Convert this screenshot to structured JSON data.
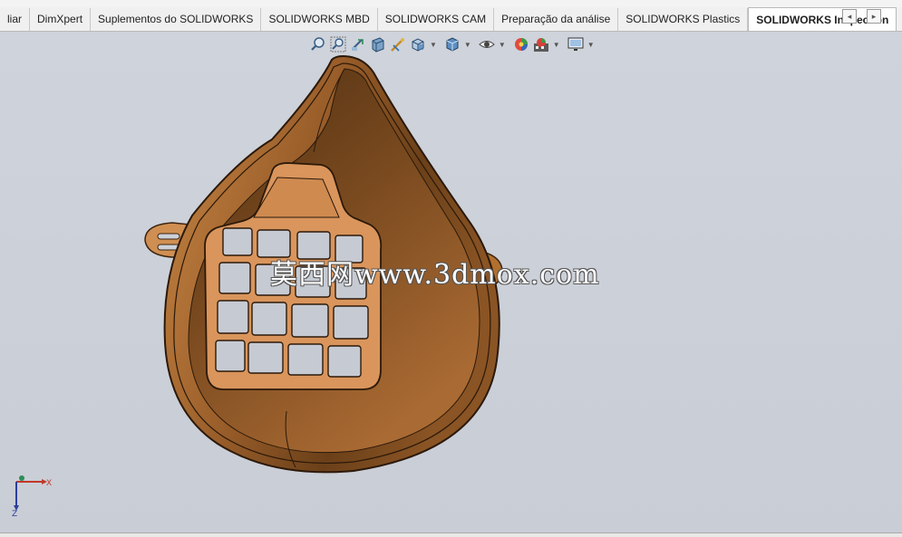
{
  "tabs": [
    {
      "label": "liar",
      "active": false
    },
    {
      "label": "DimXpert",
      "active": false
    },
    {
      "label": "Suplementos do SOLIDWORKS",
      "active": false
    },
    {
      "label": "SOLIDWORKS MBD",
      "active": false
    },
    {
      "label": "SOLIDWORKS CAM",
      "active": false
    },
    {
      "label": "Preparação da análise",
      "active": false
    },
    {
      "label": "SOLIDWORKS Plastics",
      "active": false
    },
    {
      "label": "SOLIDWORKS Inspection",
      "active": true
    }
  ],
  "tab_nav": {
    "prev": "◂",
    "next": "▸"
  },
  "headsup_toolbar": [
    "zoom-to-fit-icon",
    "zoom-to-area-icon",
    "previous-view-icon",
    "section-view-icon",
    "dynamic-annotation-icon",
    "view-orientation-icon",
    "display-style-icon",
    "hide-show-items-icon",
    "edit-appearance-icon",
    "apply-scene-icon",
    "view-settings-icon"
  ],
  "watermark": "莫西网www.3dmox.com",
  "triad": {
    "x": "X",
    "z": "Z"
  },
  "colors": {
    "model_base": "#b8773f",
    "model_dark": "#5a3616",
    "model_light": "#d9955c",
    "background": "#cdd1d9"
  }
}
